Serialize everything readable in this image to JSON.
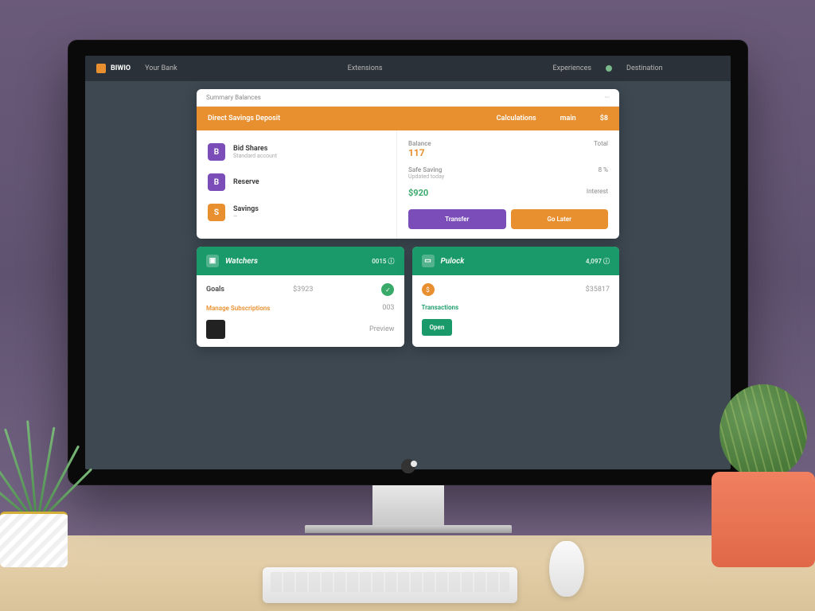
{
  "nav": {
    "brand": "BIWIO",
    "links": [
      "Your Bank",
      "Extensions",
      "Experiences",
      "Destination"
    ]
  },
  "panel1": {
    "subheader_l": "Summary Balances",
    "subheader_r": "···",
    "header_l": "Direct Savings Deposit",
    "header_m": "Calculations",
    "header_r1": "main",
    "header_r2": "$8",
    "items": [
      {
        "icon": "B",
        "title": "Bid Shares",
        "sub": "Standard account",
        "color": "purple"
      },
      {
        "icon": "B",
        "title": "Reserve",
        "sub": "",
        "color": "purple"
      },
      {
        "icon": "S",
        "title": "Savings",
        "sub": "—",
        "color": "orange"
      }
    ],
    "stats": [
      {
        "label": "Balance",
        "value": "117",
        "right": "Total",
        "vclass": "stat-v"
      },
      {
        "label": "Safe Saving",
        "sub": "Updated today",
        "right": "8 %",
        "vclass": ""
      },
      {
        "label": "",
        "value": "$920",
        "right": "Interest",
        "vclass": "stat-vg"
      }
    ],
    "btn_primary": "Transfer",
    "btn_secondary": "Go Later"
  },
  "cards": [
    {
      "icon": "▣",
      "title": "Watchers",
      "right": "0015  ⓘ",
      "row1_l": "Goals",
      "row1_v": "$3923",
      "dot": "green",
      "dotv": "✓",
      "link": "Manage Subscriptions",
      "link_v": "003",
      "thumb_label": "Preview"
    },
    {
      "icon": "▭",
      "title": "Pulock",
      "right": "4,097  ⓘ",
      "row1_l": "",
      "row1_v": "$35817",
      "dot": "orange",
      "dotv": "$",
      "link": "Transactions",
      "link_v": "",
      "btn": "Open"
    }
  ]
}
